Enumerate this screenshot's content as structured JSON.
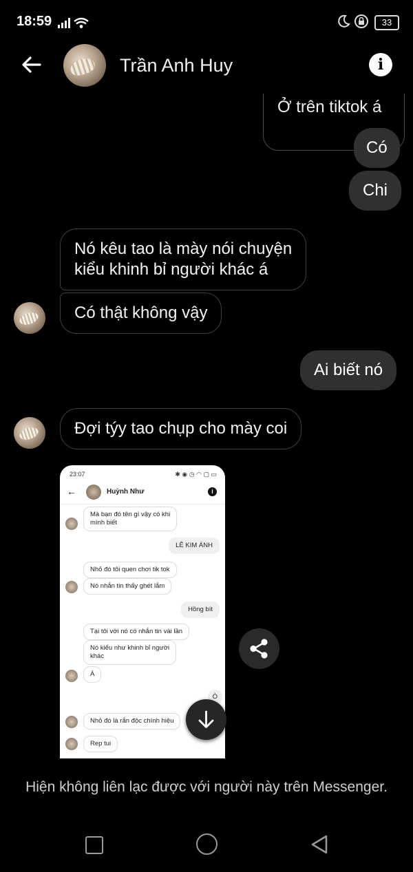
{
  "status_bar": {
    "time": "18:59",
    "battery": "33"
  },
  "header": {
    "contact_name": "Trần Anh Huy"
  },
  "messages": {
    "reply_quote": "Ở trên tiktok á",
    "m1": "Có",
    "m2": "Chi",
    "m3_line1": "Nó kêu tao là mày nói chuyện",
    "m3_line2": "kiểu khinh bỉ người khác á",
    "m4": "Có thật không vậy",
    "m5": "Ai biết nó",
    "m6": "Đợi týy tao chụp cho mày coi"
  },
  "embedded_screenshot": {
    "time": "23:07",
    "contact_name": "Huỳnh Như",
    "lines": [
      "Mà bạn đó tên gì vậy có khi",
      "mình biết",
      "LÊ KIM ÁNH",
      "Nhỏ đó tôi quen chơi tik tok",
      "Nó nhắn tin thấy ghét lắm",
      "Hồng bít",
      "Tại tôi với nó có nhắn tin vài lần",
      "Nó kiểu như khinh bỉ người",
      "khác",
      "Á",
      "Ò",
      "Nhỏ đó là rắn độc chính hiệu",
      "Rep tui"
    ]
  },
  "notice": "Hiện không liên lạc được với người này trên Messenger."
}
